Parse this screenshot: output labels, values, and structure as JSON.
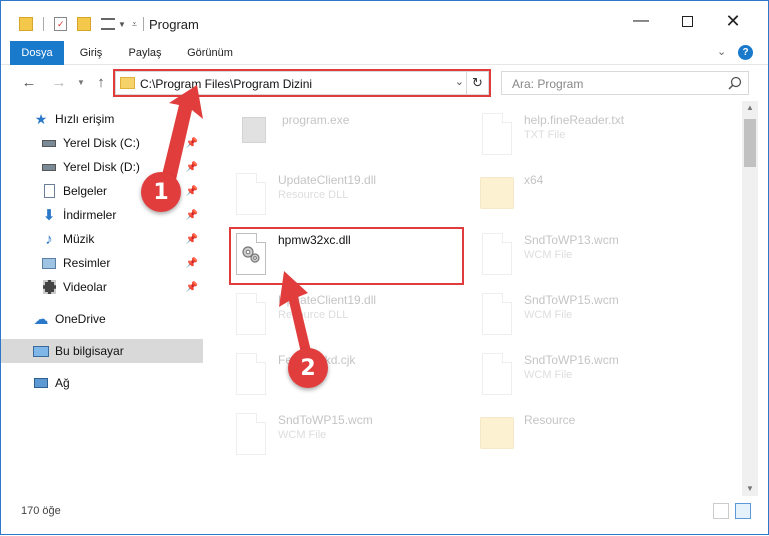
{
  "window": {
    "title": "Program"
  },
  "ribbon": {
    "tabs": [
      "Dosya",
      "Giriş",
      "Paylaş",
      "Görünüm"
    ],
    "active_tab": "Dosya"
  },
  "address": {
    "path": "C:\\Program Files\\Program Dizini"
  },
  "search": {
    "placeholder": "Ara: Program"
  },
  "sidebar": {
    "items": [
      {
        "label": "Hızlı erişim",
        "icon": "star-icon"
      },
      {
        "label": "Yerel Disk (C:)",
        "icon": "drive-icon",
        "pinned": true
      },
      {
        "label": "Yerel Disk (D:)",
        "icon": "drive-icon",
        "pinned": true
      },
      {
        "label": "Belgeler",
        "icon": "documents-icon",
        "pinned": true
      },
      {
        "label": "İndirmeler",
        "icon": "download-icon",
        "pinned": true
      },
      {
        "label": "Müzik",
        "icon": "music-icon",
        "pinned": true
      },
      {
        "label": "Resimler",
        "icon": "pictures-icon",
        "pinned": true
      },
      {
        "label": "Videolar",
        "icon": "video-icon",
        "pinned": true
      },
      {
        "label": "OneDrive",
        "icon": "cloud-icon"
      },
      {
        "label": "Bu bilgisayar",
        "icon": "computer-icon",
        "selected": true
      },
      {
        "label": "Ağ",
        "icon": "network-icon"
      }
    ]
  },
  "files": [
    {
      "name": "program.exe",
      "type": "",
      "kind": "exe"
    },
    {
      "name": "help.fineReader.txt",
      "type": "TXT File",
      "kind": "doc"
    },
    {
      "name": "UpdateClient19.dll",
      "type": "Resource DLL",
      "kind": "dll"
    },
    {
      "name": "x64",
      "type": "",
      "kind": "folder"
    },
    {
      "name": "hpmw32xc.dll",
      "type": "",
      "kind": "dll"
    },
    {
      "name": "SndToWP13.wcm",
      "type": "WCM File",
      "kind": "doc"
    },
    {
      "name": "UpdateClient19.dll",
      "type": "Resource DLL",
      "kind": "dll"
    },
    {
      "name": "SndToWP15.wcm",
      "type": "WCM File",
      "kind": "doc"
    },
    {
      "name": "Feedbackd.cjk",
      "type": "",
      "kind": "doc"
    },
    {
      "name": "SndToWP16.wcm",
      "type": "WCM File",
      "kind": "doc"
    },
    {
      "name": "SndToWP15.wcm",
      "type": "WCM File",
      "kind": "doc"
    },
    {
      "name": "Resource",
      "type": "",
      "kind": "folder"
    }
  ],
  "status": {
    "count": "170 öğe"
  },
  "callouts": [
    "1",
    "2"
  ],
  "colors": {
    "accent": "#1979ca",
    "highlight": "#e03c3c"
  }
}
